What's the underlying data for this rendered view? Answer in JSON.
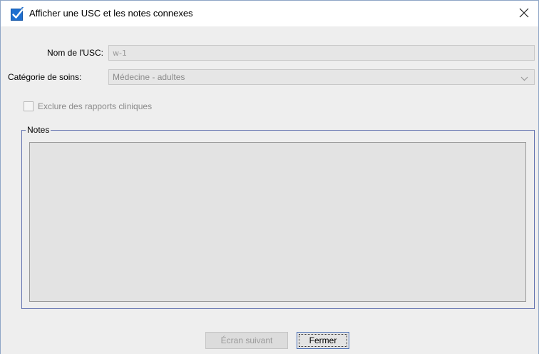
{
  "window": {
    "title": "Afficher une USC et les notes connexes"
  },
  "form": {
    "usc_name_label": "Nom de l'USC:",
    "usc_name_value": "w-1",
    "care_category_label": "Catégorie de soins:",
    "care_category_value": "Médecine - adultes",
    "exclude_label": "Exclure des rapports cliniques",
    "exclude_checked": false
  },
  "notes": {
    "legend": "Notes",
    "value": ""
  },
  "buttons": {
    "next_screen": "Écran suivant",
    "close": "Fermer"
  },
  "icons": {
    "app": "checkbox-app-icon",
    "close": "close-icon",
    "dropdown": "chevron-down-icon"
  },
  "colors": {
    "accent": "#1e6fd0",
    "panel_bg": "#eeeeee",
    "fieldset_border": "#5f6fae"
  }
}
